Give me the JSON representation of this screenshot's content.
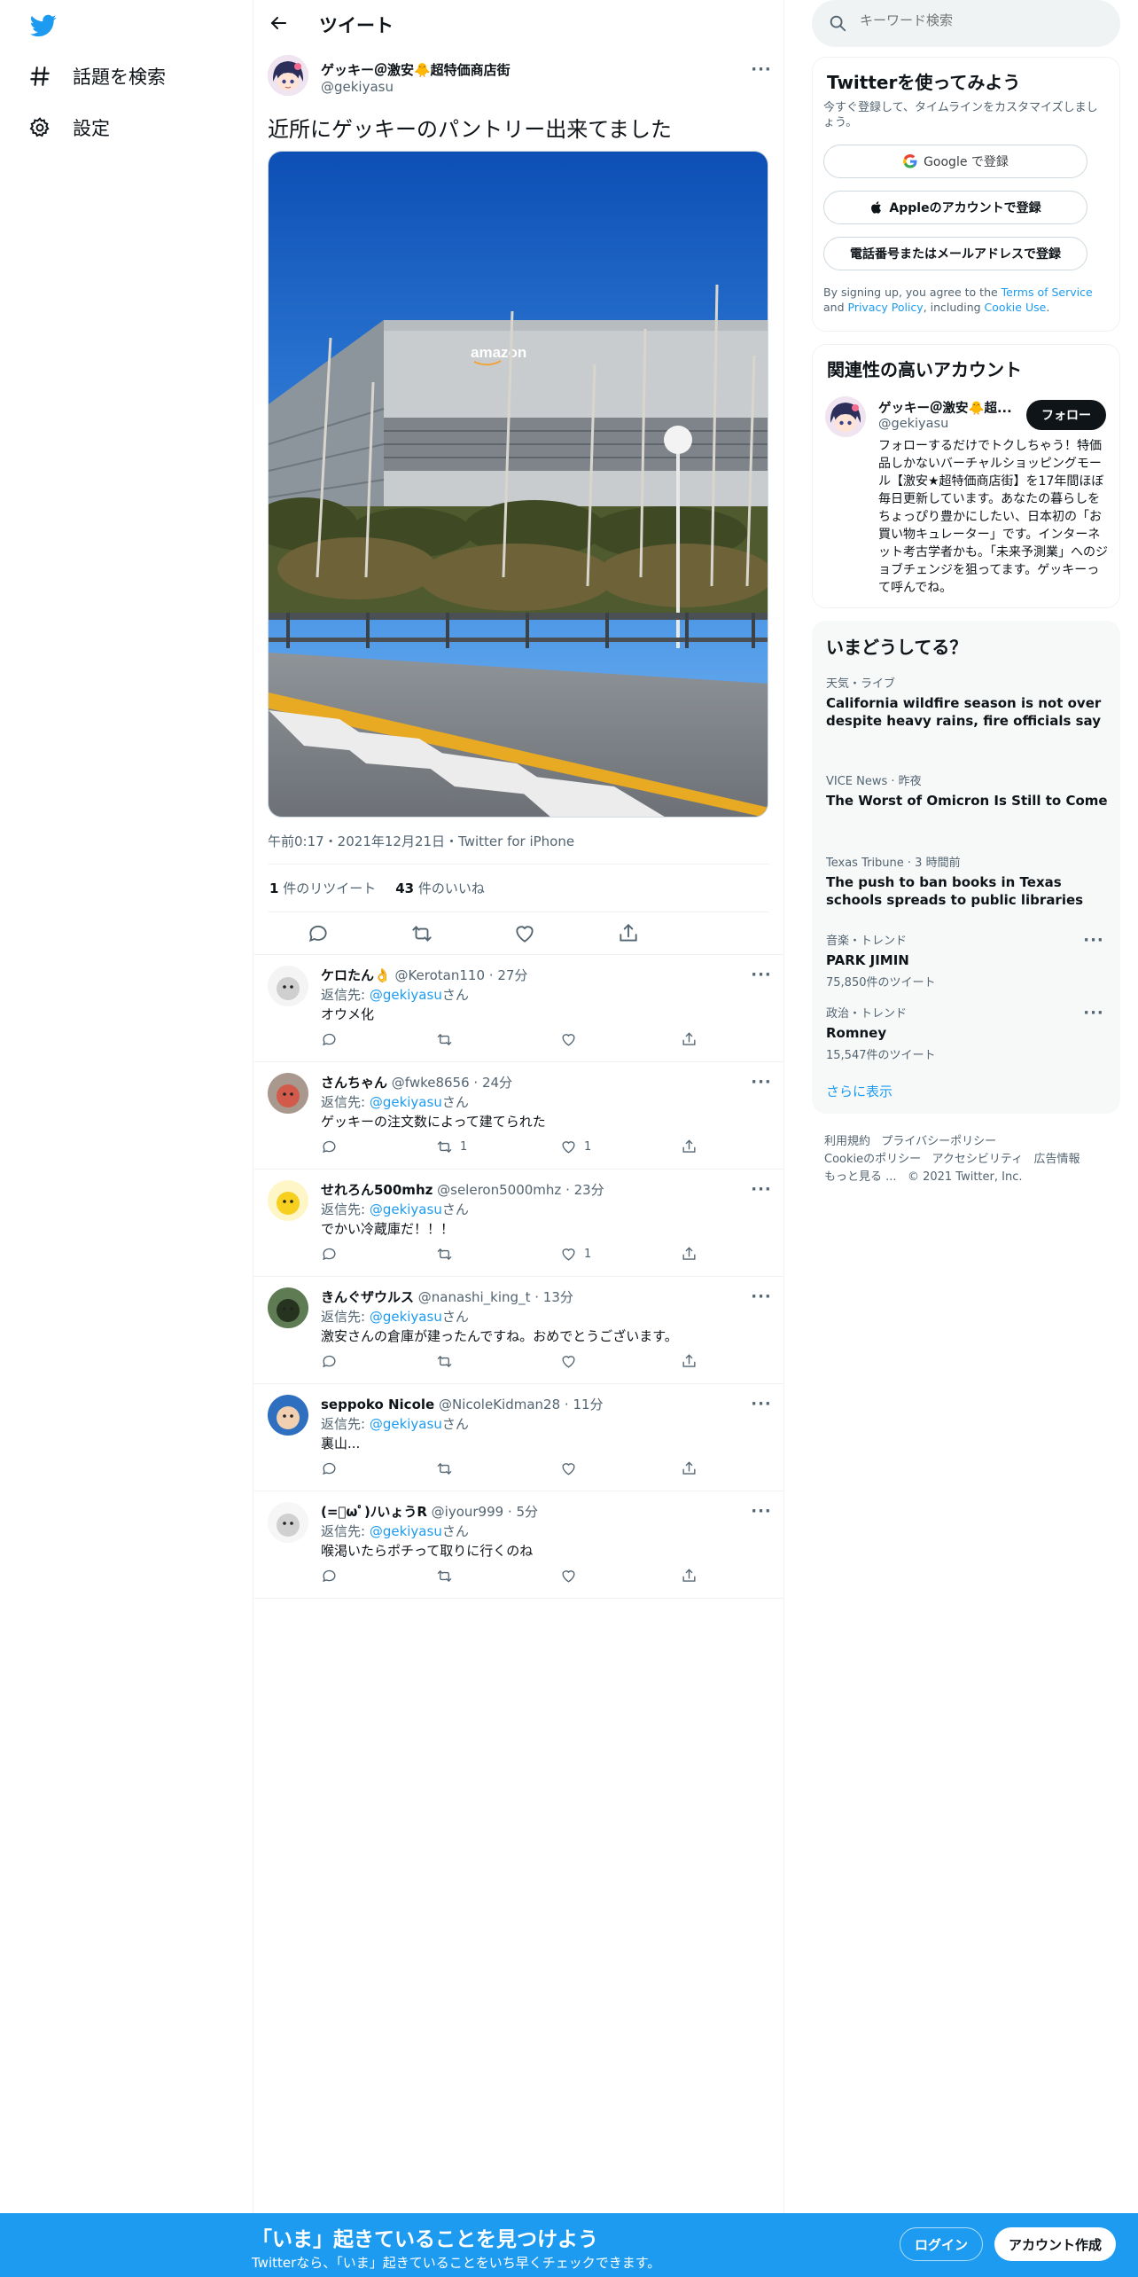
{
  "colors": {
    "brand": "#1d9bf0",
    "text": "#0f1419",
    "muted": "#536471",
    "border": "#eff3f4"
  },
  "nav": {
    "logo_icon": "twitter-bird-icon",
    "explore": "話題を検索",
    "settings": "設定"
  },
  "header": {
    "title": "ツイート"
  },
  "tweet": {
    "name": "ゲッキー＠激安🐥超特価商店街",
    "handle": "@gekiyasu",
    "text": "近所にゲッキーのパントリー出来てました",
    "meta": "午前0:17・2021年12月21日・Twitter for iPhone",
    "retweet_count": "1",
    "retweet_label": " 件のリツイート",
    "like_count": "43",
    "like_label": " 件のいいね",
    "building_sign": "amazon"
  },
  "replies": [
    {
      "name": "ケロたん👌",
      "handle": "@Kerotan110",
      "time": "· 27分",
      "to_label": "返信先: ",
      "to": "@gekiyasu",
      "to_suffix": "さん",
      "text": "オウメ化",
      "retweets": "",
      "likes": ""
    },
    {
      "name": "さんちゃん",
      "handle": "@fwke8656",
      "time": "· 24分",
      "to_label": "返信先: ",
      "to": "@gekiyasu",
      "to_suffix": "さん",
      "text": "ゲッキーの注文数によって建てられた",
      "retweets": "1",
      "likes": "1"
    },
    {
      "name": "せれろん500mhz",
      "handle": "@seleron5000mhz",
      "time": "· 23分",
      "to_label": "返信先: ",
      "to": "@gekiyasu",
      "to_suffix": "さん",
      "text": "でかい冷蔵庫だ！！！",
      "retweets": "",
      "likes": "1"
    },
    {
      "name": "きんぐザウルス",
      "handle": "@nanashi_king_t",
      "time": "· 13分",
      "to_label": "返信先: ",
      "to": "@gekiyasu",
      "to_suffix": "さん",
      "text": "激安さんの倉庫が建ったんですね。おめでとうございます。",
      "retweets": "",
      "likes": ""
    },
    {
      "name": "seppoko Nicole",
      "handle": "@NicoleKidman28",
      "time": "· 11分",
      "to_label": "返信先: ",
      "to": "@gekiyasu",
      "to_suffix": "さん",
      "text": "裏山...",
      "retweets": "",
      "likes": ""
    },
    {
      "name": "(=ﾟωﾟ)ﾉいょうR",
      "handle": "@iyour999",
      "time": "· 5分",
      "to_label": "返信先: ",
      "to": "@gekiyasu",
      "to_suffix": "さん",
      "text": "喉渇いたらポチって取りに行くのね",
      "retweets": "",
      "likes": ""
    }
  ],
  "search": {
    "placeholder": "キーワード検索"
  },
  "signup_card": {
    "title": "Twitterを使ってみよう",
    "subtitle": "今すぐ登録して、タイムラインをカスタマイズしましょう。",
    "google": "Google で登録",
    "apple": "Appleのアカウントで登録",
    "phone": "電話番号またはメールアドレスで登録",
    "terms_pre": "By signing up, you agree to the ",
    "terms": "Terms of Service",
    "terms_mid": " and ",
    "privacy": "Privacy Policy",
    "terms_mid2": ", including ",
    "cookie": "Cookie Use",
    "terms_end": "."
  },
  "relevant": {
    "title": "関連性の高いアカウント",
    "name": "ゲッキー＠激安🐥超...",
    "handle": "@gekiyasu",
    "follow": "フォロー",
    "bio": "フォローするだけでトクしちゃう！特価品しかないバーチャルショッピングモール【激安★超特価商店街】を17年間ほぼ毎日更新しています。あなたの暮らしをちょっぴり豊かにしたい、日本初の「お買い物キュレーター」です。インターネット考古学者かも。「未来予測業」へのジョブチェンジを狙ってます。ゲッキーって呼んでね。"
  },
  "trends": {
    "title": "いまどうしてる？",
    "items": [
      {
        "category": "天気・ライブ",
        "title": "California wildfire season is not over despite heavy rains, fire officials say",
        "count": ""
      },
      {
        "category": "VICE News · 昨夜",
        "title": "The Worst of Omicron Is Still to Come",
        "count": ""
      },
      {
        "category": "Texas Tribune · 3 時間前",
        "title": "The push to ban books in Texas schools spreads to public libraries",
        "count": ""
      },
      {
        "category": "音楽・トレンド",
        "title": "PARK JIMIN",
        "count": "75,850件のツイート"
      },
      {
        "category": "政治・トレンド",
        "title": "Romney",
        "count": "15,547件のツイート"
      }
    ],
    "show_more": "さらに表示"
  },
  "footer": {
    "line1a": "利用規約",
    "line1b": "プライバシーポリシー",
    "line2a": "Cookieのポリシー",
    "line2b": "アクセシビリティ",
    "line2c": "広告情報",
    "line3a": "もっと見る ...",
    "line3b": "© 2021 Twitter, Inc."
  },
  "bottom_bar": {
    "title": "「いま」起きていることを見つけよう",
    "subtitle": "Twitterなら、「いま」起きていることをいち早くチェックできます。",
    "login": "ログイン",
    "signup": "アカウント作成"
  }
}
